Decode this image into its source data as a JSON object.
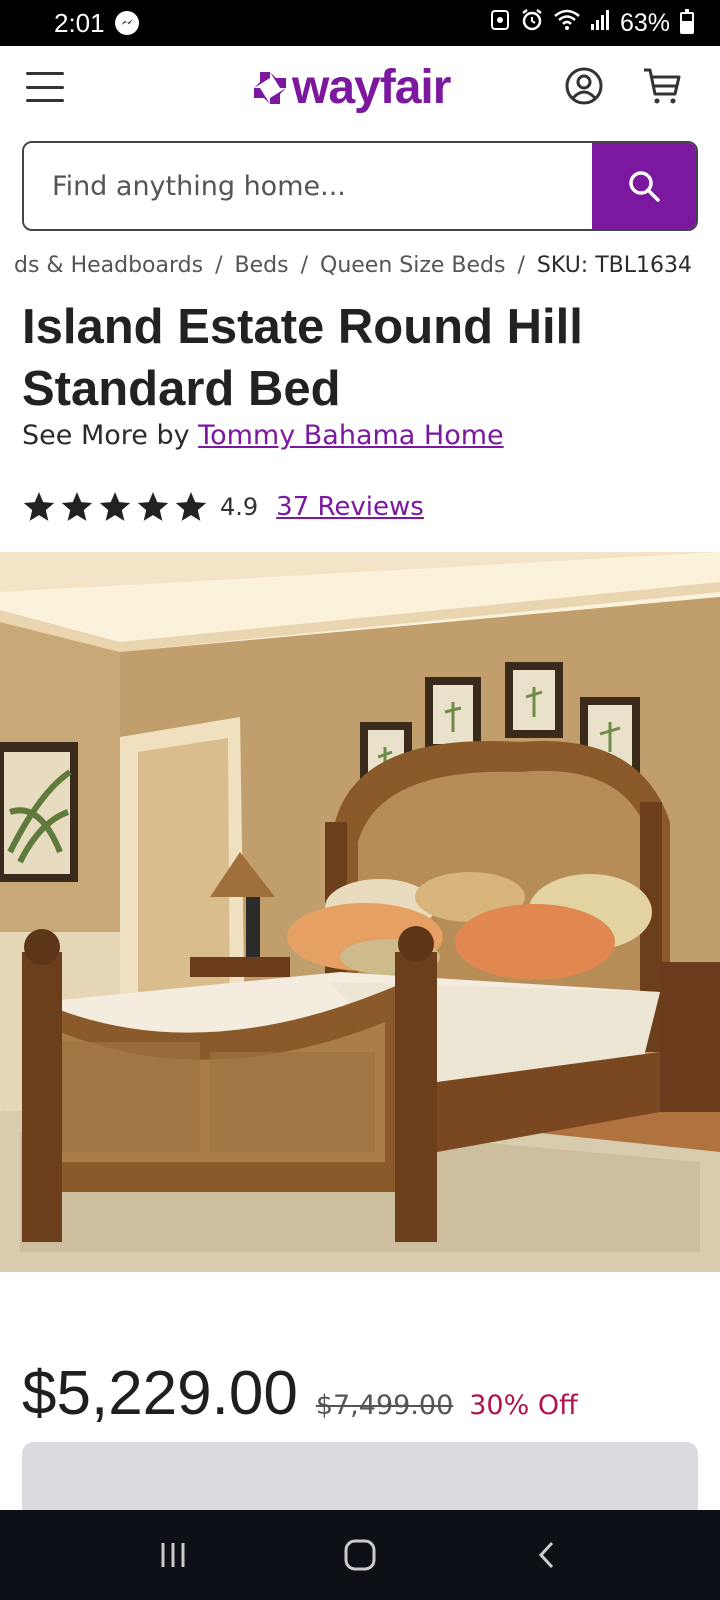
{
  "status_bar": {
    "time": "2:01",
    "battery_text": "63%",
    "battery_level": 0.63
  },
  "header": {
    "logo_text": "wayfair",
    "brand_color": "#7b189f"
  },
  "search": {
    "placeholder": "Find anything home..."
  },
  "breadcrumb": {
    "items": [
      "ds & Headboards",
      "Beds",
      "Queen Size Beds"
    ],
    "current": "SKU: TBL1634",
    "separator": "/"
  },
  "product": {
    "title": "Island Estate Round Hill Standard Bed",
    "see_more_prefix": "See More by",
    "brand": "Tommy Bahama Home",
    "rating": "4.9",
    "stars": 5,
    "reviews": "37 Reviews",
    "price": "$5,229.00",
    "was_price": "$7,499.00",
    "discount": "30% Off",
    "discount_color": "#b3114b"
  }
}
